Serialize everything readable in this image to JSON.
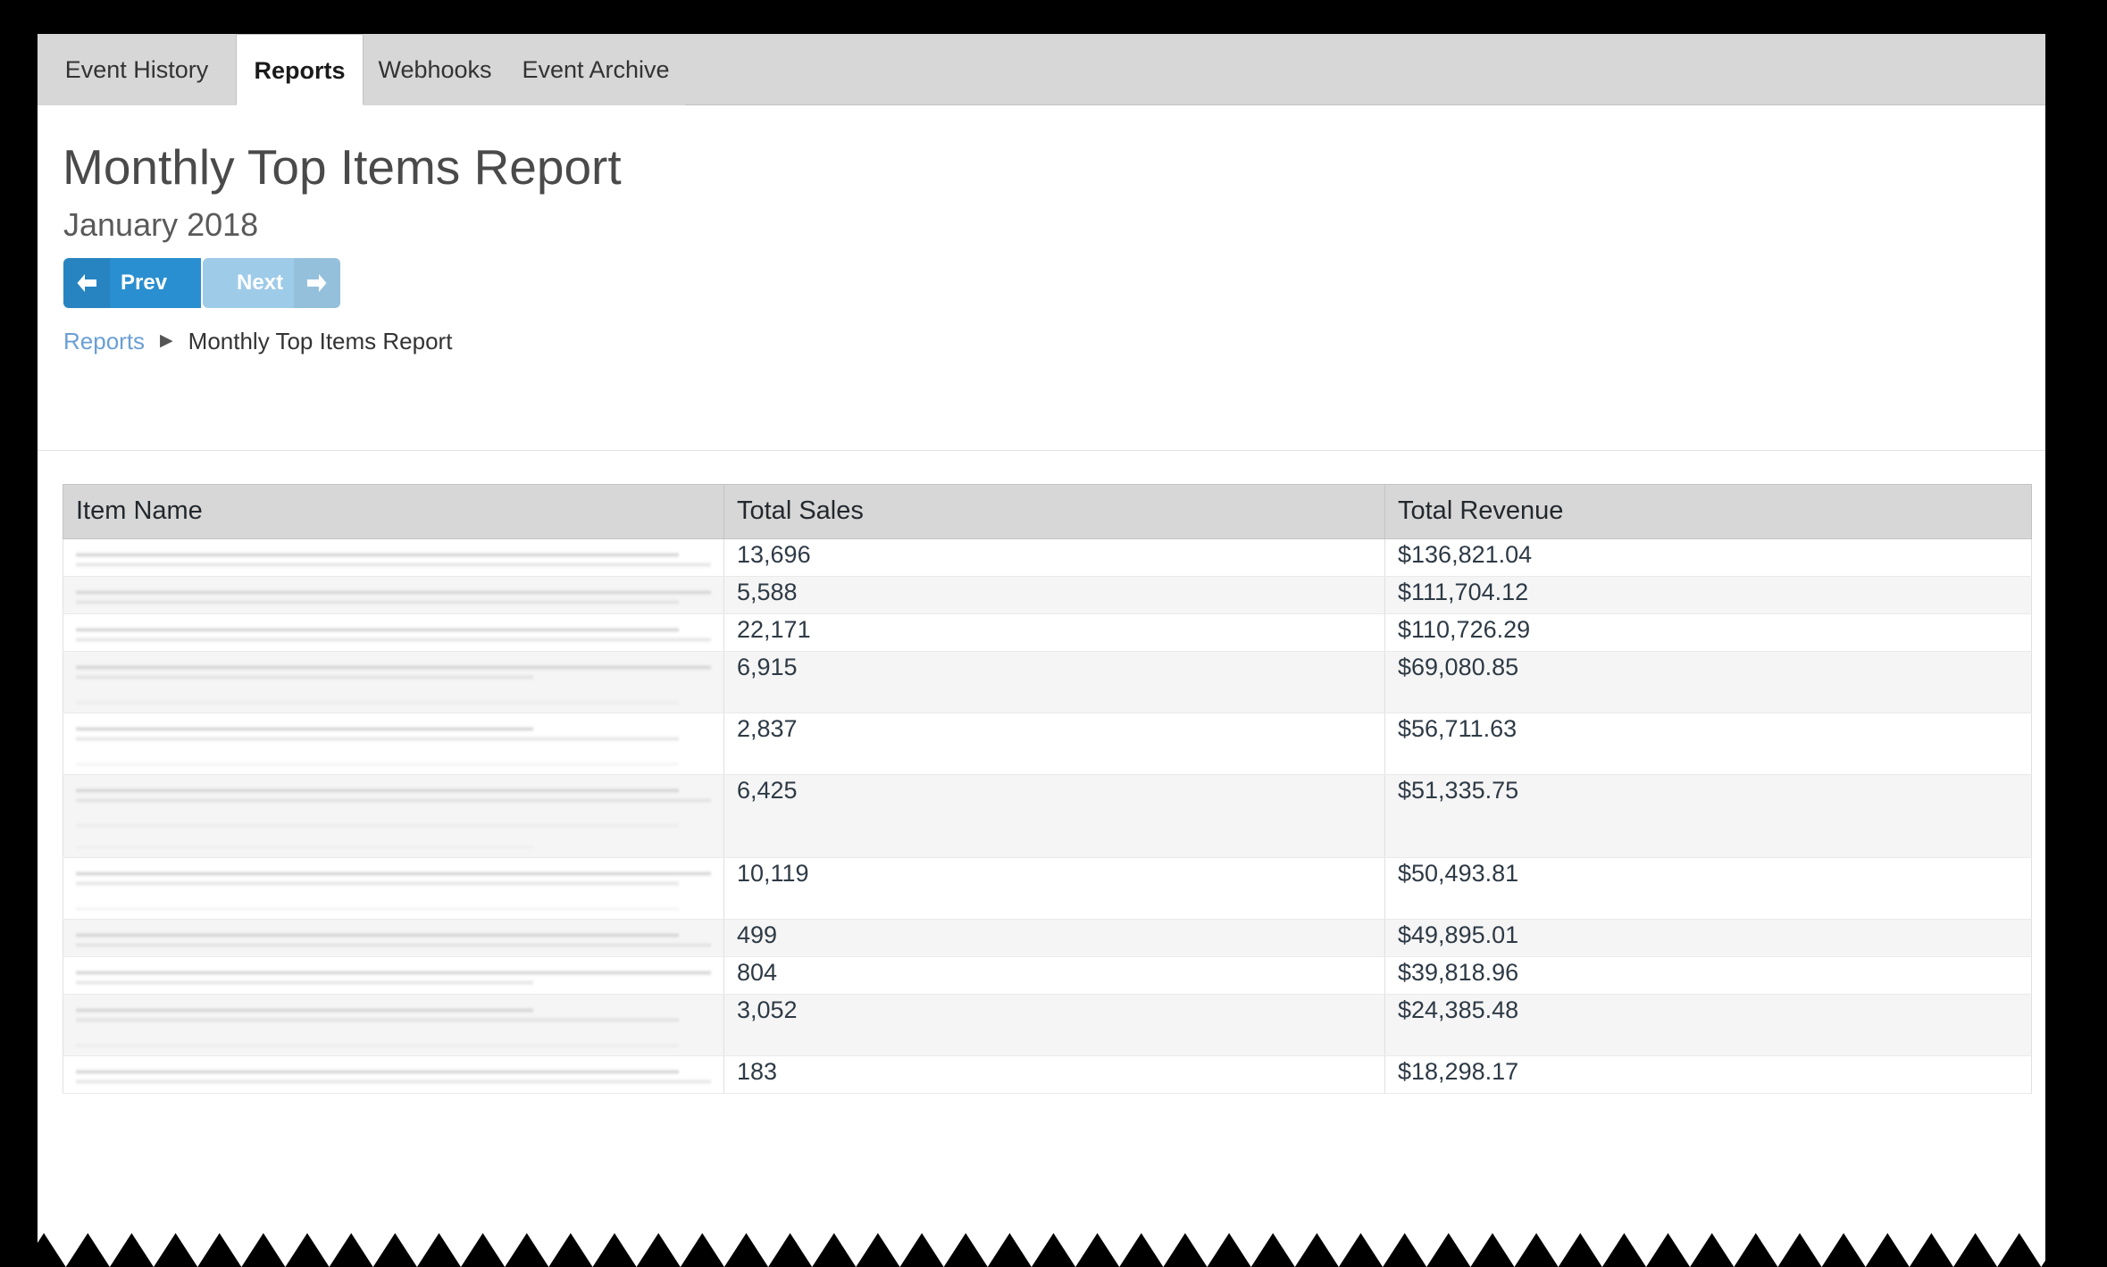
{
  "window": {
    "background_color": "#000000",
    "page_background": "#ffffff"
  },
  "tabs": {
    "items": [
      {
        "label": "Event History",
        "active": false
      },
      {
        "label": "Reports",
        "active": true
      },
      {
        "label": "Webhooks",
        "active": false
      },
      {
        "label": "Event Archive",
        "active": false
      }
    ],
    "active_index": 1,
    "strip_color": "#d7d7d7"
  },
  "header": {
    "title": "Monthly Top Items Report",
    "subtitle": "January 2018"
  },
  "pager": {
    "prev_label": "Prev",
    "next_label": "Next",
    "prev_icon": "arrow-left-icon",
    "next_icon": "arrow-right-icon",
    "prev_enabled": true,
    "next_enabled": false,
    "prev_color": "#2a8fd0",
    "next_color": "#9ecbe8"
  },
  "breadcrumb": {
    "root_label": "Reports",
    "separator": "▶",
    "current_label": "Monthly Top Items Report",
    "link_color": "#6a9fd4"
  },
  "table": {
    "columns": [
      "Item Name",
      "Total Sales",
      "Total Revenue"
    ],
    "header_background": "#d7d7d7",
    "item_name_redacted": true,
    "rows": [
      {
        "item_name": "",
        "total_sales": "13,696",
        "total_revenue": "$136,821.04",
        "lines": 1
      },
      {
        "item_name": "",
        "total_sales": "5,588",
        "total_revenue": "$111,704.12",
        "lines": 1
      },
      {
        "item_name": "",
        "total_sales": "22,171",
        "total_revenue": "$110,726.29",
        "lines": 1
      },
      {
        "item_name": "",
        "total_sales": "6,915",
        "total_revenue": "$69,080.85",
        "lines": 2
      },
      {
        "item_name": "",
        "total_sales": "2,837",
        "total_revenue": "$56,711.63",
        "lines": 2
      },
      {
        "item_name": "",
        "total_sales": "6,425",
        "total_revenue": "$51,335.75",
        "lines": 3
      },
      {
        "item_name": "",
        "total_sales": "10,119",
        "total_revenue": "$50,493.81",
        "lines": 2
      },
      {
        "item_name": "",
        "total_sales": "499",
        "total_revenue": "$49,895.01",
        "lines": 1
      },
      {
        "item_name": "",
        "total_sales": "804",
        "total_revenue": "$39,818.96",
        "lines": 1
      },
      {
        "item_name": "",
        "total_sales": "3,052",
        "total_revenue": "$24,385.48",
        "lines": 2
      },
      {
        "item_name": "",
        "total_sales": "183",
        "total_revenue": "$18,298.17",
        "lines": 1
      }
    ]
  },
  "footer": {
    "truncated": true,
    "torn_edge": true
  }
}
